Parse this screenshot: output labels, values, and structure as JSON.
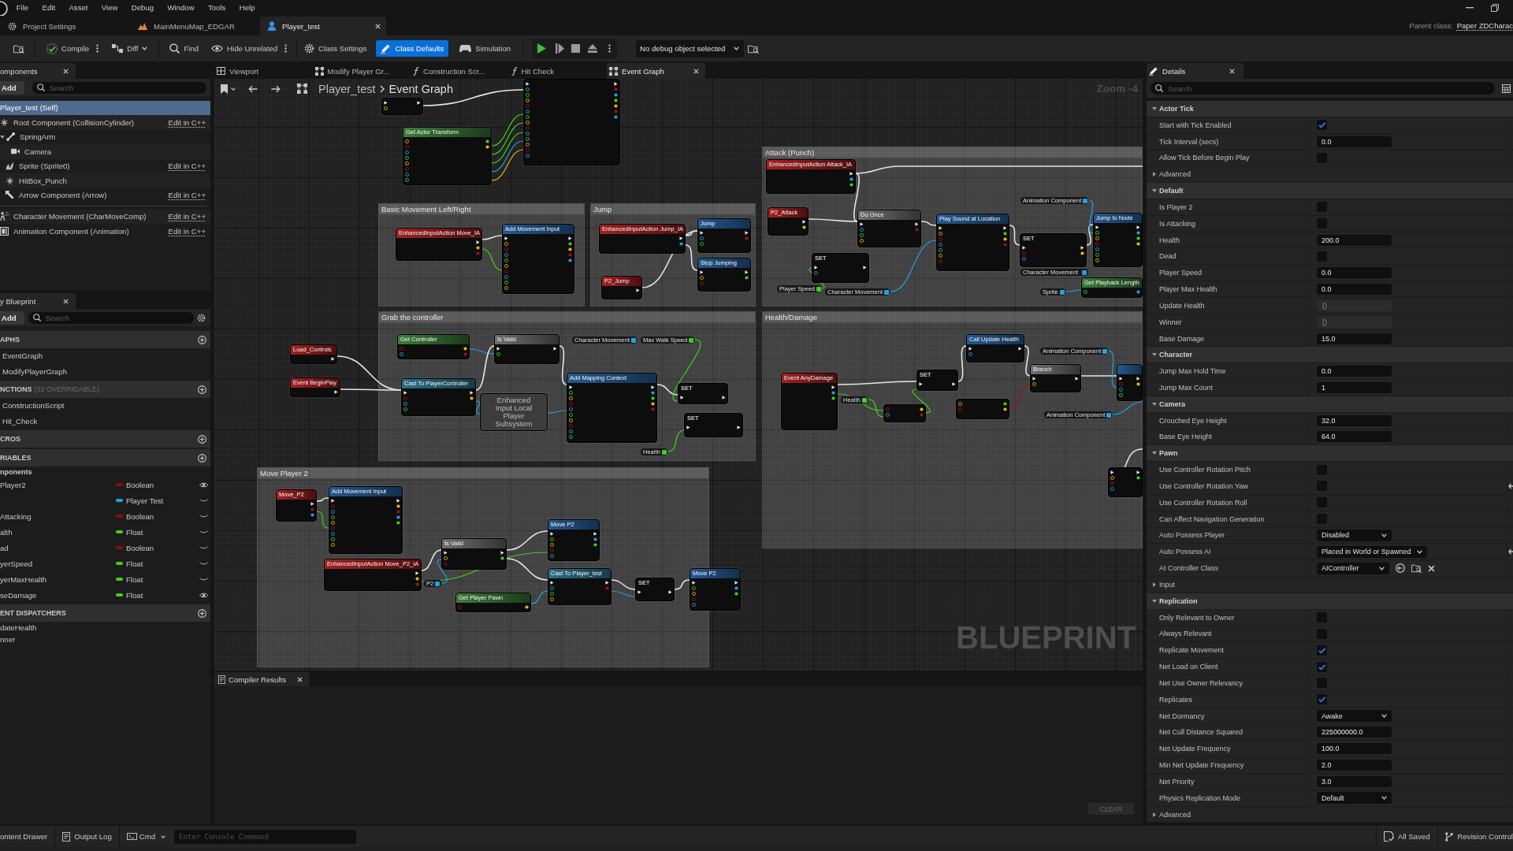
{
  "menu_bar": {
    "items": [
      "File",
      "Edit",
      "Asset",
      "View",
      "Debug",
      "Window",
      "Tools",
      "Help"
    ]
  },
  "document_tabs": [
    {
      "label": "Project Settings",
      "selected": false
    },
    {
      "label": "MainMenuMap_EDGAR",
      "selected": false
    },
    {
      "label": "Player_test",
      "selected": true
    }
  ],
  "parent_class": {
    "label": "Parent class:",
    "value": "Paper ZDCharac"
  },
  "toolbar": {
    "buttons": [
      {
        "label": "Compile",
        "kind": "split",
        "selected": false
      },
      {
        "label": "Diff",
        "kind": "dropdown",
        "selected": false
      },
      {
        "label": "Find",
        "kind": "button",
        "selected": false
      },
      {
        "label": "Hide Unrelated",
        "kind": "split",
        "selected": false
      },
      {
        "label": "Class Settings",
        "kind": "button",
        "selected": false
      },
      {
        "label": "Class Defaults",
        "kind": "button",
        "selected": true
      },
      {
        "label": "Simulation",
        "kind": "button",
        "selected": false
      }
    ],
    "debug_object": "No debug object selected"
  },
  "components": {
    "tab": "omponents",
    "add": "Add",
    "search": {
      "placeholder": "Search"
    },
    "tree": [
      {
        "label": "Player_test (Self)",
        "selected": true,
        "children": [
          {
            "label": "Root Component (CollisionCylinder)",
            "kind": "collision",
            "link": "Edit in C++",
            "selected": false,
            "children": [
              {
                "label": "SpringArm",
                "kind": "spring-arm",
                "selected": false,
                "expanded": true,
                "children": [
                  {
                    "label": "Camera",
                    "kind": "camera",
                    "selected": false
                  }
                ]
              },
              {
                "label": "Sprite (Sprite0)",
                "kind": "sprite",
                "link": "Edit in C++",
                "selected": false
              },
              {
                "label": "HitBox_Punch",
                "kind": "collision",
                "selected": false
              },
              {
                "label": "Arrow Component (Arrow)",
                "kind": "arrow",
                "link": "Edit in C++",
                "selected": false
              }
            ]
          }
        ]
      }
    ],
    "other": [
      {
        "label": "Character Movement (CharMoveComp)",
        "kind": "movement",
        "link": "Edit in C++",
        "selected": false
      },
      {
        "label": "Animation Component (Animation)",
        "kind": "animation",
        "link": "Edit in C++",
        "selected": false
      }
    ]
  },
  "my_blueprint": {
    "tab": "y Blueprint",
    "add": "Add",
    "search": {
      "placeholder": "Search"
    },
    "sections": [
      {
        "kind": "list",
        "title": "APHS",
        "items": [
          "EventGraph",
          "ModifyPlayerGraph"
        ]
      },
      {
        "kind": "list",
        "title": "NCTIONS",
        "note": "(32 OVERRIDABLE)",
        "items": [
          "ConstructionScript",
          "Hit_Check"
        ]
      },
      {
        "kind": "list",
        "title": "CROS"
      },
      {
        "kind": "variables",
        "title": "RIABLES",
        "category": "nponents",
        "variables": [
          {
            "name": "Player2",
            "type": "Boolean",
            "color": "#8e0b0b",
            "exposed": true
          },
          {
            "type": "Player Test",
            "color": "#1ea3e6",
            "exposed": false
          },
          {
            "name": "Attacking",
            "type": "Boolean",
            "color": "#8e0b0b",
            "exposed": false
          },
          {
            "name": "alth",
            "type": "Float",
            "color": "#3dd11b",
            "exposed": false
          },
          {
            "name": "ad",
            "type": "Boolean",
            "color": "#8e0b0b",
            "exposed": false
          },
          {
            "name": "yerSpeed",
            "type": "Float",
            "color": "#3dd11b",
            "exposed": false
          },
          {
            "name": "yerMaxHealth",
            "type": "Float",
            "color": "#3dd11b",
            "exposed": false
          },
          {
            "name": "seDamage",
            "type": "Float",
            "color": "#3dd11b",
            "exposed": true
          }
        ]
      },
      {
        "kind": "dispatchers",
        "title": "ENT DISPATCHERS",
        "items": [
          "dateHealth",
          "nner"
        ]
      }
    ]
  },
  "graph_tabs": [
    {
      "label": "Viewport",
      "selected": false
    },
    {
      "label": "Modify Player Gr...",
      "selected": false
    },
    {
      "label": "Construction Scr...",
      "selected": false
    },
    {
      "label": "Hit Check",
      "selected": false
    },
    {
      "label": "Event Graph",
      "selected": true
    }
  ],
  "graph": {
    "breadcrumb": {
      "blueprint": "Player_test",
      "graph": "Event Graph"
    },
    "zoom": "Zoom -4",
    "label": "BLUEPRINT",
    "comments": [
      {
        "title": "Attack (Punch)"
      },
      {
        "title": "Basic Movement Left/Right"
      },
      {
        "title": "Jump"
      },
      {
        "title": "Grab the controller"
      },
      {
        "title": "Health/Damage"
      },
      {
        "title": "Move Player 2"
      }
    ],
    "nodes": [
      {
        "kind": "partial"
      },
      {
        "kind": "pure",
        "title": "Get Actor Transform"
      },
      {
        "kind": "partial"
      },
      {
        "kind": "event",
        "title": "EnhancedInputAction Attack_IA"
      },
      {
        "kind": "getter",
        "title": "Animation Component",
        "color": "#1ea3e6"
      },
      {
        "kind": "event",
        "title": "P2_Attack"
      },
      {
        "kind": "macro",
        "title": "Do Once"
      },
      {
        "kind": "function",
        "title": "Jump to Node"
      },
      {
        "kind": "function",
        "title": "Play Sound at Location"
      },
      {
        "kind": "set",
        "title": "SET"
      },
      {
        "kind": "set",
        "title": "SET"
      },
      {
        "kind": "getter",
        "title": "Character Movement",
        "color": "#1ea3e6"
      },
      {
        "kind": "pure",
        "title": "Get Playback Length"
      },
      {
        "kind": "getter",
        "title": "Player Speed",
        "color": "#3dd11b"
      },
      {
        "kind": "getter",
        "title": "Character Movement",
        "color": "#1ea3e6"
      },
      {
        "kind": "getter",
        "title": "Sprite",
        "color": "#1ea3e6"
      },
      {
        "kind": "function",
        "title": "Add Movement Input"
      },
      {
        "kind": "event",
        "title": "EnhancedInputAction Move_IA"
      },
      {
        "kind": "function",
        "title": "Jump"
      },
      {
        "kind": "event",
        "title": "EnhancedInputAction Jump_IA"
      },
      {
        "kind": "function",
        "title": "Stop Jumping"
      },
      {
        "kind": "event",
        "title": "P2_Jump"
      },
      {
        "kind": "pure",
        "title": "Get Controller"
      },
      {
        "kind": "macro",
        "title": "Is Valid"
      },
      {
        "kind": "getter",
        "title": "Character Movement",
        "color": "#1ea3e6"
      },
      {
        "kind": "getter",
        "title": "Max Walk Speed",
        "color": "#3dd11b"
      },
      {
        "kind": "event",
        "title": "Load_Controls"
      },
      {
        "kind": "function",
        "title": "Add Mapping Context"
      },
      {
        "kind": "event",
        "title": "Event BeginPlay"
      },
      {
        "kind": "cast",
        "title": "Cast To PlayerController"
      },
      {
        "kind": "set",
        "title": "SET"
      },
      {
        "kind": "compact",
        "title": "Enhanced Input Local Player Subsystem"
      },
      {
        "kind": "set",
        "title": "SET"
      },
      {
        "kind": "getter",
        "title": "Health",
        "color": "#3dd11b"
      },
      {
        "kind": "function",
        "title": "Call Update Health"
      },
      {
        "kind": "getter",
        "title": "Animation Component",
        "color": "#1ea3e6"
      },
      {
        "kind": "macro",
        "title": "Branch"
      },
      {
        "kind": "function"
      },
      {
        "kind": "set",
        "title": "SET"
      },
      {
        "kind": "event",
        "title": "Event AnyDamage"
      },
      {
        "kind": "getter",
        "title": "Health",
        "color": "#3dd11b"
      },
      {
        "kind": "math"
      },
      {
        "kind": "math"
      },
      {
        "kind": "getter",
        "title": "Animation Component",
        "color": "#1ea3e6"
      },
      {
        "kind": "set"
      },
      {
        "kind": "function",
        "title": "Add Movement Input"
      },
      {
        "kind": "event",
        "title": "Move_P2"
      },
      {
        "kind": "function",
        "title": "Move P2"
      },
      {
        "kind": "macro",
        "title": "Is Valid"
      },
      {
        "kind": "event",
        "title": "EnhancedInputAction Move_P2_IA"
      },
      {
        "kind": "cast",
        "title": "Cast To Player_test"
      },
      {
        "kind": "function",
        "title": "Move P2"
      },
      {
        "kind": "set",
        "title": "SET"
      },
      {
        "kind": "getter",
        "title": "P2",
        "color": "#1ea3e6"
      },
      {
        "kind": "pure",
        "title": "Get Player Pawn"
      }
    ]
  },
  "compiler_results": {
    "tab": "Compiler Results",
    "clear": "CLEAR"
  },
  "details": {
    "tab": "Details",
    "search": {
      "placeholder": "Search"
    },
    "sections": [
      {
        "title": "Actor Tick",
        "expanded": true,
        "rows": [
          {
            "kind": "checkbox",
            "label": "Start with Tick Enabled",
            "checked": true,
            "modified": false
          },
          {
            "kind": "number",
            "label": "Tick Interval (secs)",
            "value": "0.0",
            "modified": false
          },
          {
            "kind": "checkbox",
            "label": "Allow Tick Before Begin Play",
            "checked": false,
            "modified": false
          },
          {
            "kind": "group",
            "label": "Advanced",
            "expanded": false
          }
        ]
      },
      {
        "title": "Default",
        "expanded": true,
        "rows": [
          {
            "kind": "checkbox",
            "label": "Is Player 2",
            "checked": false,
            "modified": false
          },
          {
            "kind": "checkbox",
            "label": "Is Attacking",
            "checked": false,
            "modified": false
          },
          {
            "kind": "number",
            "label": "Health",
            "value": "200.0",
            "modified": false
          },
          {
            "kind": "checkbox",
            "label": "Dead",
            "checked": false,
            "modified": false
          },
          {
            "kind": "number",
            "label": "Player Speed",
            "value": "0.0",
            "modified": false
          },
          {
            "kind": "number",
            "label": "Player Max Health",
            "value": "0.0",
            "modified": false
          },
          {
            "kind": "readonly",
            "label": "Update Health",
            "value": "()",
            "modified": false
          },
          {
            "kind": "readonly",
            "label": "Winner",
            "value": "()",
            "modified": false
          },
          {
            "kind": "number",
            "label": "Base Damage",
            "value": "15.0",
            "modified": false
          }
        ]
      },
      {
        "title": "Character",
        "expanded": true,
        "rows": [
          {
            "kind": "number",
            "label": "Jump Max Hold Time",
            "value": "0.0",
            "modified": false
          },
          {
            "kind": "number",
            "label": "Jump Max Count",
            "value": "1",
            "modified": false
          }
        ]
      },
      {
        "title": "Camera",
        "expanded": true,
        "rows": [
          {
            "kind": "number",
            "label": "Crouched Eye Height",
            "value": "32.0",
            "modified": false
          },
          {
            "kind": "number",
            "label": "Base Eye Height",
            "value": "64.0",
            "modified": false
          }
        ]
      },
      {
        "title": "Pawn",
        "expanded": true,
        "rows": [
          {
            "kind": "checkbox",
            "label": "Use Controller Rotation Pitch",
            "checked": false,
            "modified": false
          },
          {
            "kind": "checkbox",
            "label": "Use Controller Rotation Yaw",
            "checked": false,
            "modified": true
          },
          {
            "kind": "checkbox",
            "label": "Use Controller Rotation Roll",
            "checked": false,
            "modified": false
          },
          {
            "kind": "checkbox",
            "label": "Can Affect Navigation Generation",
            "checked": false,
            "modified": false
          },
          {
            "kind": "dropdown",
            "label": "Auto Possess Player",
            "value": "Disabled",
            "modified": false
          },
          {
            "kind": "dropdown",
            "label": "Auto Possess AI",
            "value": "Placed in World or Spawned",
            "modified": true
          },
          {
            "kind": "class",
            "label": "AI Controller Class",
            "value": "AIController",
            "modified": false
          },
          {
            "kind": "group",
            "label": "Input",
            "expanded": false
          }
        ]
      },
      {
        "title": "Replication",
        "expanded": true,
        "rows": [
          {
            "kind": "checkbox",
            "label": "Only Relevant to Owner",
            "checked": false,
            "modified": false
          },
          {
            "kind": "checkbox",
            "label": "Always Relevant",
            "checked": false,
            "modified": false
          },
          {
            "kind": "checkbox",
            "label": "Replicate Movement",
            "checked": true,
            "modified": false
          },
          {
            "kind": "checkbox",
            "label": "Net Load on Client",
            "checked": true,
            "modified": false
          },
          {
            "kind": "checkbox",
            "label": "Net Use Owner Relevancy",
            "checked": false,
            "modified": false
          },
          {
            "kind": "checkbox",
            "label": "Replicates",
            "checked": true,
            "modified": false
          },
          {
            "kind": "dropdown",
            "label": "Net Dormancy",
            "value": "Awake",
            "modified": false
          },
          {
            "kind": "number",
            "label": "Net Cull Distance Squared",
            "value": "225000000.0",
            "modified": false
          },
          {
            "kind": "number",
            "label": "Net Update Frequency",
            "value": "100.0",
            "modified": false
          },
          {
            "kind": "number",
            "label": "Min Net Update Frequency",
            "value": "2.0",
            "modified": false
          },
          {
            "kind": "number",
            "label": "Net Priority",
            "value": "3.0",
            "modified": false
          },
          {
            "kind": "dropdown",
            "label": "Physics Replication Mode",
            "value": "Default",
            "modified": false
          },
          {
            "kind": "group",
            "label": "Advanced",
            "expanded": false
          }
        ]
      }
    ]
  },
  "status_bar": {
    "content_drawer": "ontent Drawer",
    "output_log": "Output Log",
    "cmd": "Cmd",
    "console": {
      "placeholder": "Enter Console Command"
    },
    "save_state": "All Saved",
    "revision_control": "Revision Control"
  }
}
